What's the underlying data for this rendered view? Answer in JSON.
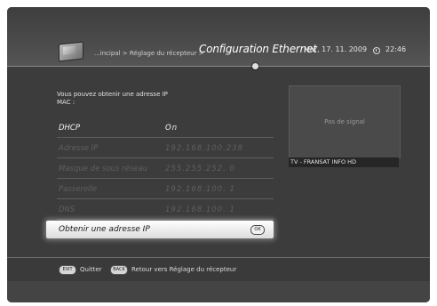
{
  "header": {
    "breadcrumb": "...incipal > Réglage du récepteur >",
    "title": "Configuration Ethernet",
    "date": "Mar, 17. 11. 2009",
    "time": "22:46"
  },
  "intro": {
    "line1": "Vous pouvez obtenir une adresse IP",
    "line2": "MAC :"
  },
  "menu": {
    "rows": [
      {
        "label": "DHCP",
        "value": "On"
      },
      {
        "label": "Adresse IP",
        "value": "192.168.100.238"
      },
      {
        "label": "Masque de sous réseau",
        "value": "255.255.252.  0"
      },
      {
        "label": "Passerelle",
        "value": "192.168.100.  1"
      },
      {
        "label": "DNS",
        "value": "192.168.100.  1"
      }
    ],
    "selected_label": "Obtenir une adresse IP",
    "ok_label": "OK"
  },
  "preview": {
    "status": "Pas de signal",
    "channel": "TV - FRANSAT INFO HD"
  },
  "footer": {
    "exit_key": "EXIT",
    "exit_text": "Quitter",
    "back_key": "BACK",
    "back_text": "Retour vers Réglage du récepteur"
  },
  "icons": {
    "tv": "tv-icon",
    "clock": "clock-icon"
  },
  "colors": {
    "background": "#3c3c3c",
    "highlight": "#f0f0f0",
    "inactive_text": "#5f5f5f"
  }
}
